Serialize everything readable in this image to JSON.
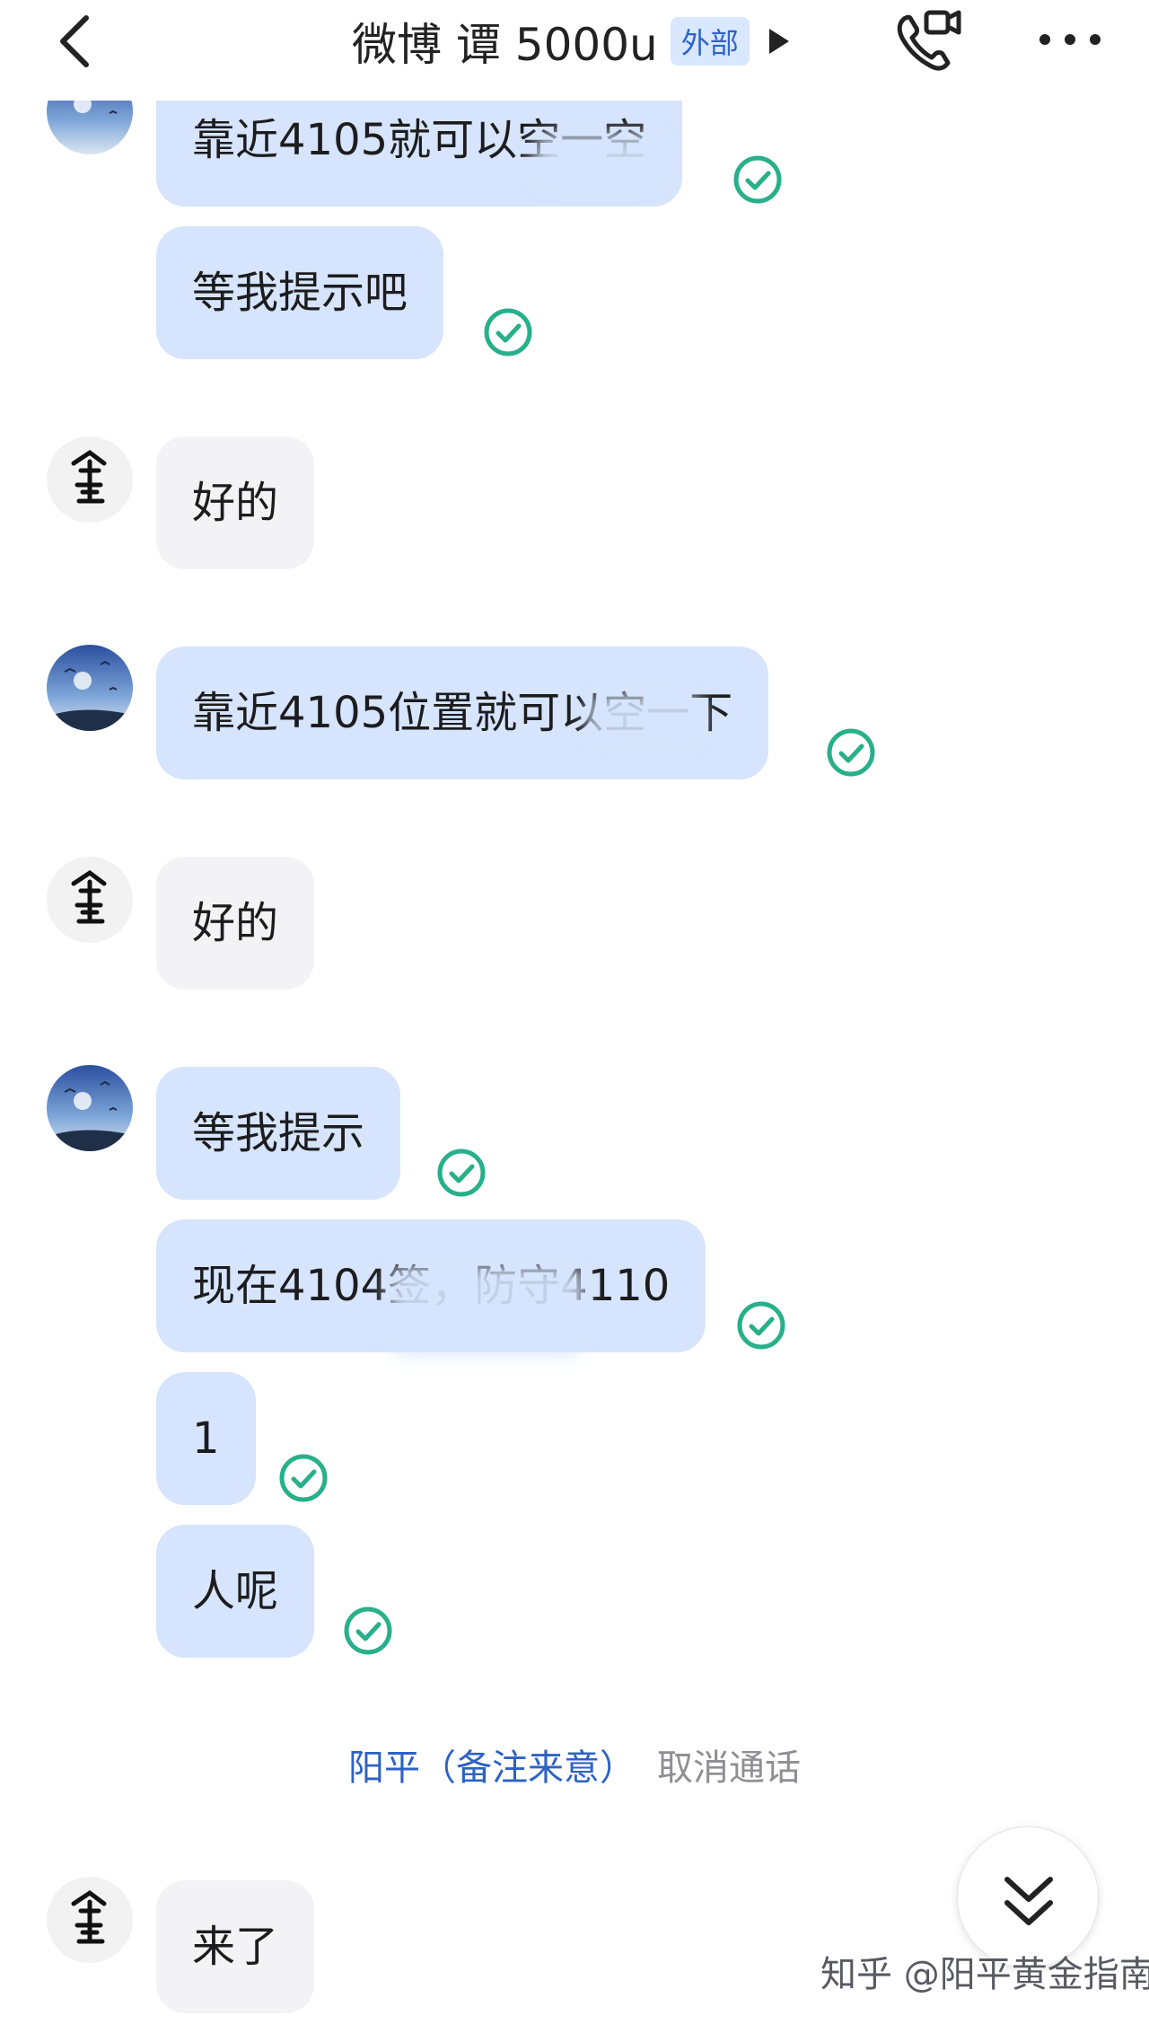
{
  "header": {
    "title": "微博 谭 5000u",
    "badge": "外部",
    "back_icon": "chevron-left-icon",
    "call_icon": "phone-video-icon",
    "more_icon": "more-dots-icon"
  },
  "messages": [
    {
      "sender": "self",
      "text": "靠近4105就可以空一空",
      "read": true
    },
    {
      "sender": "self",
      "text": "等我提示吧",
      "read": true
    },
    {
      "sender": "peer",
      "text": "好的"
    },
    {
      "sender": "self",
      "text": "靠近4105位置就可以空一下",
      "read": true
    },
    {
      "sender": "peer",
      "text": "好的"
    },
    {
      "sender": "self",
      "text": "等我提示",
      "read": true
    },
    {
      "sender": "self",
      "text": "现在4104签，防守4110",
      "read": true
    },
    {
      "sender": "self",
      "text": "1",
      "read": true
    },
    {
      "sender": "self",
      "text": "人呢",
      "read": true
    },
    {
      "sender": "peer",
      "text": "来了"
    }
  ],
  "system": {
    "name": "阳平（备注来意）",
    "action": "取消通话"
  },
  "watermark": "知乎 @阳平黄金指南",
  "colors": {
    "self_bubble": "#d6e4fd",
    "peer_bubble": "#f3f3f5",
    "read_check": "#27b08a",
    "link_blue": "#2d62c4"
  }
}
